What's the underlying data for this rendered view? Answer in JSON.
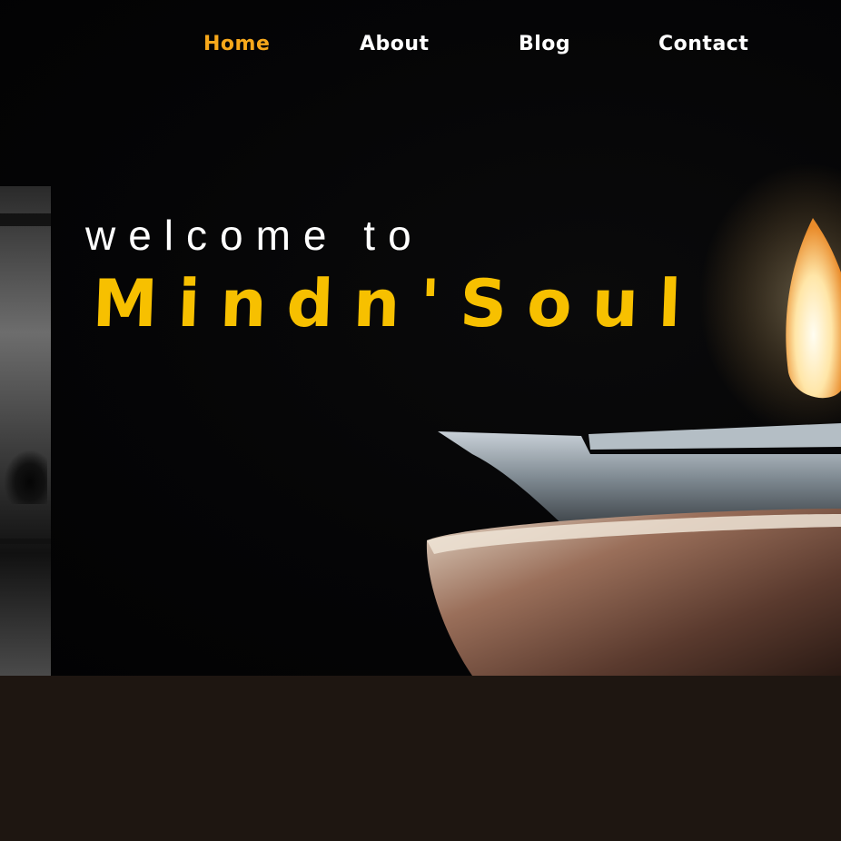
{
  "nav": {
    "items": [
      {
        "label": "Home",
        "active": true
      },
      {
        "label": "About",
        "active": false
      },
      {
        "label": "Blog",
        "active": false
      },
      {
        "label": "Contact",
        "active": false
      }
    ]
  },
  "hero": {
    "welcome_text": "welcome to",
    "brand_name": "Mindn'Soul"
  },
  "colors": {
    "accent": "#f7a81b",
    "brand": "#f7c000",
    "footer_bg": "#1e1611",
    "hero_bg": "#050506"
  },
  "images": {
    "side_photo": "yoga-silhouette-photo",
    "hero_photo": "oil-lamp-candle-photo"
  }
}
